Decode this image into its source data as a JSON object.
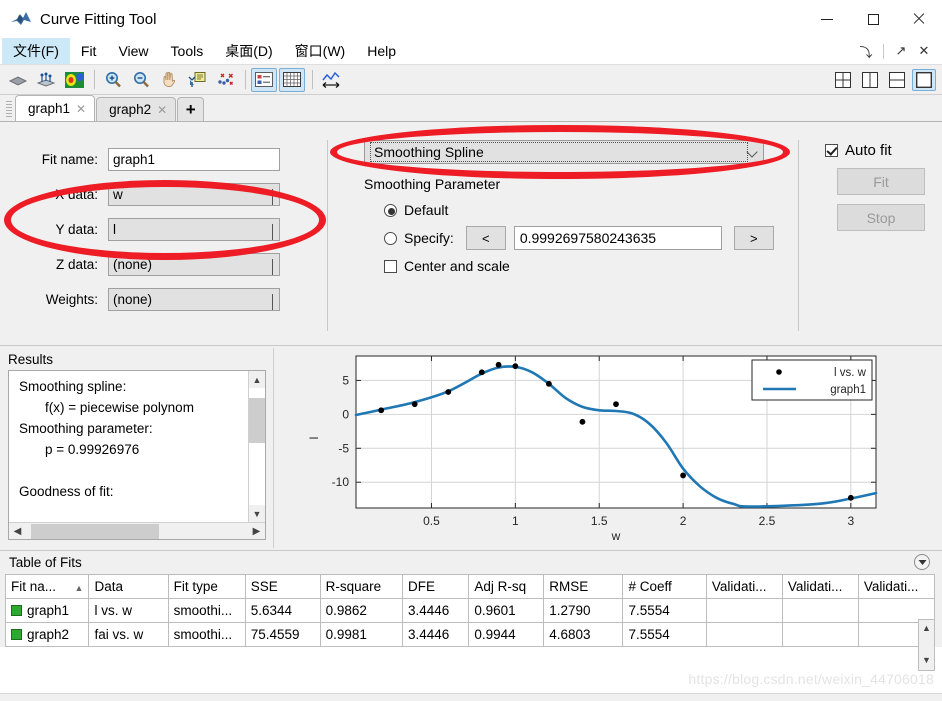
{
  "window": {
    "title": "Curve Fitting Tool",
    "icon": "matlab-curvefit-icon",
    "minimize": "—",
    "maximize": "□",
    "close": "✕"
  },
  "menubar": {
    "items": [
      {
        "label": "文件(F)",
        "active": true
      },
      {
        "label": "Fit",
        "active": false
      },
      {
        "label": "View",
        "active": false
      },
      {
        "label": "Tools",
        "active": false
      },
      {
        "label": "桌面(D)",
        "active": false
      },
      {
        "label": "窗口(W)",
        "active": false
      },
      {
        "label": "Help",
        "active": false
      }
    ],
    "right_buttons": [
      {
        "name": "dock-arrow-icon",
        "glyph": "⤵"
      },
      {
        "name": "undock-arrow-icon",
        "glyph": "↗"
      },
      {
        "name": "close-panel-icon",
        "glyph": "✕"
      }
    ]
  },
  "toolbar": {
    "buttons": [
      {
        "name": "surface-plot-icon",
        "pressed": false
      },
      {
        "name": "residuals-plot-icon",
        "pressed": false
      },
      {
        "name": "contour-plot-icon",
        "pressed": false
      },
      {
        "name": "zoom-in-icon",
        "pressed": false
      },
      {
        "name": "zoom-out-icon",
        "pressed": false
      },
      {
        "name": "pan-icon",
        "pressed": false
      },
      {
        "name": "data-cursor-icon",
        "pressed": false
      },
      {
        "name": "exclude-outliers-icon",
        "pressed": false
      },
      {
        "name": "legend-toggle-icon",
        "pressed": true
      },
      {
        "name": "grid-toggle-icon",
        "pressed": true
      },
      {
        "name": "axes-limits-icon",
        "pressed": false
      }
    ],
    "layout_buttons": [
      {
        "name": "layout-quad-icon",
        "selected": false
      },
      {
        "name": "layout-vertical-split-icon",
        "selected": false
      },
      {
        "name": "layout-horizontal-split-icon",
        "selected": false
      },
      {
        "name": "layout-single-icon",
        "selected": true
      }
    ]
  },
  "tabs": {
    "items": [
      {
        "label": "graph1",
        "active": true,
        "close": "✕"
      },
      {
        "label": "graph2",
        "active": false,
        "close": "✕"
      }
    ],
    "add_label": "+"
  },
  "fit_options": {
    "fit_name_label": "Fit name:",
    "fit_name_value": "graph1",
    "x_data_label": "X data:",
    "x_data_value": "w",
    "y_data_label": "Y data:",
    "y_data_value": "l",
    "z_data_label": "Z data:",
    "z_data_value": "(none)",
    "weights_label": "Weights:",
    "weights_value": "(none)",
    "fit_type_value": "Smoothing Spline",
    "smoothing_parameter_title": "Smoothing Parameter",
    "default_label": "Default",
    "default_selected": true,
    "specify_label": "Specify:",
    "specify_selected": false,
    "decrease_button": "<",
    "increase_button": ">",
    "smoothing_value": "0.9992697580243635",
    "center_and_scale_label": "Center and scale",
    "center_and_scale_checked": false,
    "auto_fit_label": "Auto fit",
    "auto_fit_checked": true,
    "fit_button": "Fit",
    "stop_button": "Stop"
  },
  "results": {
    "title": "Results",
    "lines": [
      {
        "text": "Smoothing spline:",
        "indent": false
      },
      {
        "text": "f(x) = piecewise polynom",
        "indent": true
      },
      {
        "text": "Smoothing parameter:",
        "indent": false
      },
      {
        "text": "p = 0.99926976",
        "indent": true
      },
      {
        "text": "",
        "indent": false
      },
      {
        "text": "Goodness of fit:",
        "indent": false
      }
    ]
  },
  "chart_data": {
    "type": "scatter",
    "title": "",
    "xlabel": "w",
    "ylabel": "l",
    "xlim": [
      0.05,
      3.15
    ],
    "ylim": [
      -13.8,
      8.6
    ],
    "xticks": [
      0.5,
      1,
      1.5,
      2,
      2.5,
      3
    ],
    "yticks": [
      5,
      0,
      -5,
      -10
    ],
    "grid": true,
    "legend_position": "top-right",
    "series": [
      {
        "name": "l vs. w",
        "type": "scatter",
        "marker": "circle",
        "color": "#000000",
        "x": [
          0.2,
          0.4,
          0.6,
          0.8,
          0.9,
          1.0,
          1.2,
          1.4,
          1.6,
          2.0,
          3.0
        ],
        "y": [
          0.6,
          1.5,
          3.3,
          6.2,
          7.3,
          7.1,
          4.5,
          -1.1,
          1.5,
          -9.0,
          -12.3
        ]
      },
      {
        "name": "graph1",
        "type": "line",
        "color": "#1f77b4",
        "x": [
          0.05,
          0.2,
          0.4,
          0.6,
          0.8,
          0.9,
          1.0,
          1.1,
          1.2,
          1.3,
          1.4,
          1.5,
          1.6,
          1.7,
          1.8,
          1.9,
          2.0,
          2.1,
          2.2,
          2.3,
          2.4,
          2.8,
          3.0,
          3.15
        ],
        "y": [
          -0.1,
          0.7,
          1.8,
          3.4,
          6.0,
          6.9,
          7.0,
          6.2,
          4.5,
          2.4,
          1.1,
          0.6,
          0.5,
          0.1,
          -1.4,
          -4.2,
          -8.0,
          -10.6,
          -12.3,
          -13.2,
          -13.6,
          -13.2,
          -12.4,
          -11.6
        ]
      }
    ]
  },
  "table_of_fits": {
    "title": "Table of Fits",
    "collapse_icon": "▼",
    "columns": [
      "Fit na...",
      "Data",
      "Fit type",
      "SSE",
      "R-square",
      "DFE",
      "Adj R-sq",
      "RMSE",
      "# Coeff",
      "Validati...",
      "Validati...",
      "Validati..."
    ],
    "sorted_column": 0,
    "sort_arrow": "▲",
    "rows": [
      {
        "status_color": "#2fa82f",
        "cells": [
          "graph1",
          "l vs. w",
          "smoothi...",
          "5.6344",
          "0.9862",
          "3.4446",
          "0.9601",
          "1.2790",
          "7.5554",
          "",
          "",
          ""
        ]
      },
      {
        "status_color": "#2fa82f",
        "cells": [
          "graph2",
          "fai vs. w",
          "smoothi...",
          "75.4559",
          "0.9981",
          "3.4446",
          "0.9944",
          "4.6803",
          "7.5554",
          "",
          "",
          ""
        ]
      }
    ]
  },
  "watermark": "https://blog.csdn.net/weixin_44706018"
}
